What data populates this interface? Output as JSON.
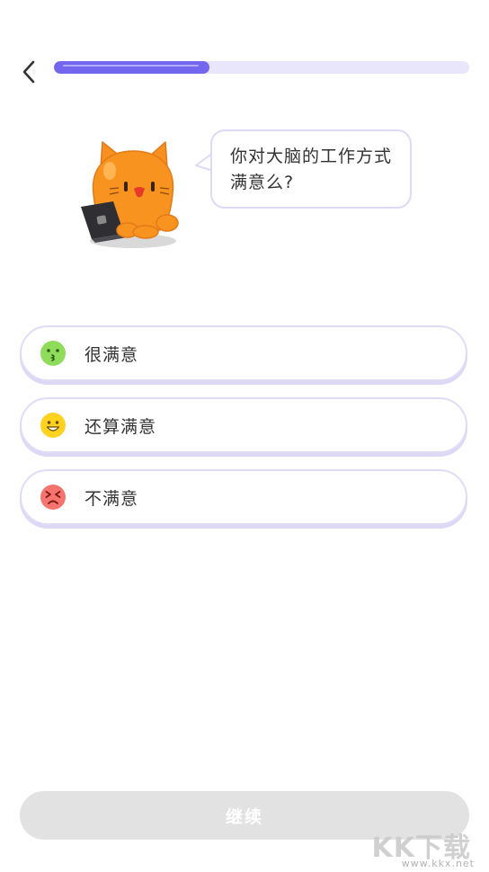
{
  "progress": {
    "fraction": 0.375,
    "fill_color": "#7367f0",
    "track_color": "#e9e6fb"
  },
  "question": {
    "text": "你对大脑的工作方式满意么?"
  },
  "options": [
    {
      "label": "很满意",
      "icon": "kissing-face-icon",
      "icon_color": "#8fdc5a"
    },
    {
      "label": "还算满意",
      "icon": "smiling-face-icon",
      "icon_color": "#ffd21f"
    },
    {
      "label": "不满意",
      "icon": "frustrated-face-icon",
      "icon_color": "#f7736d"
    }
  ],
  "footer": {
    "continue_label": "继续"
  },
  "watermark": {
    "logo_text": "KK下载",
    "url": "www.kkx.net"
  }
}
